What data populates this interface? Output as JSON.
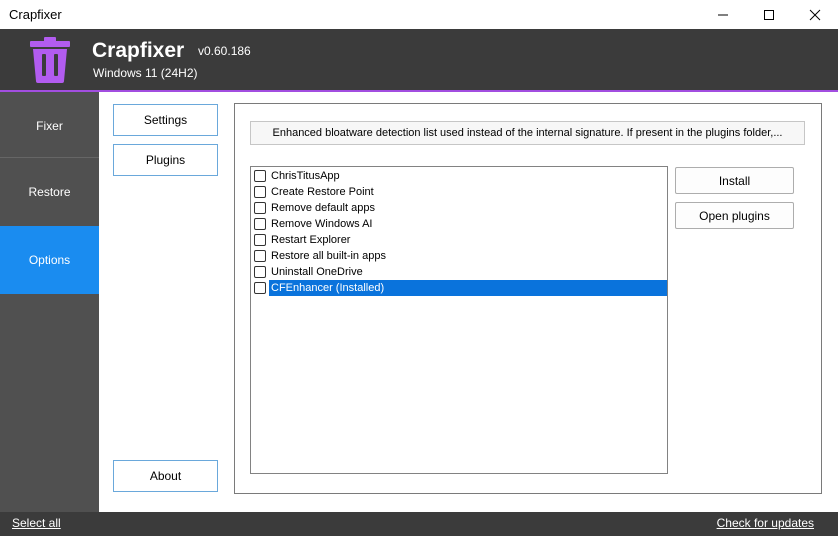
{
  "window": {
    "title": "Crapfixer",
    "controls": [
      "minimize-icon",
      "maximize-icon",
      "close-icon"
    ]
  },
  "header": {
    "app_name": "Crapfixer",
    "version": "v0.60.186",
    "os": "Windows 11 (24H2)",
    "logo_icon": "trash-can-icon",
    "logo_color": "#b25cf0"
  },
  "sidebar": {
    "items": [
      {
        "label": "Fixer",
        "active": false
      },
      {
        "label": "Restore",
        "active": false
      },
      {
        "label": "Options",
        "active": true
      }
    ]
  },
  "subnav": {
    "settings": "Settings",
    "plugins": "Plugins",
    "about": "About"
  },
  "main": {
    "info_text": "Enhanced bloatware detection list used instead of the internal signature. If present in the plugins folder,...",
    "plugins": [
      {
        "label": "ChrisTitusApp",
        "checked": false,
        "selected": false
      },
      {
        "label": "Create Restore Point",
        "checked": false,
        "selected": false
      },
      {
        "label": "Remove default apps",
        "checked": false,
        "selected": false
      },
      {
        "label": "Remove Windows AI",
        "checked": false,
        "selected": false
      },
      {
        "label": "Restart Explorer",
        "checked": false,
        "selected": false
      },
      {
        "label": "Restore all built-in apps",
        "checked": false,
        "selected": false
      },
      {
        "label": "Uninstall OneDrive",
        "checked": false,
        "selected": false
      },
      {
        "label": "CFEnhancer (Installed)",
        "checked": false,
        "selected": true
      }
    ],
    "install_button": "Install",
    "open_plugins_button": "Open plugins"
  },
  "footer": {
    "select_all": "Select all",
    "check_updates": "Check for updates"
  },
  "colors": {
    "accent": "#a24ee0",
    "nav_active": "#1a8cf0",
    "selection": "#0a73dc",
    "header_bg": "#3b3b3b",
    "sidebar_bg": "#505050"
  }
}
